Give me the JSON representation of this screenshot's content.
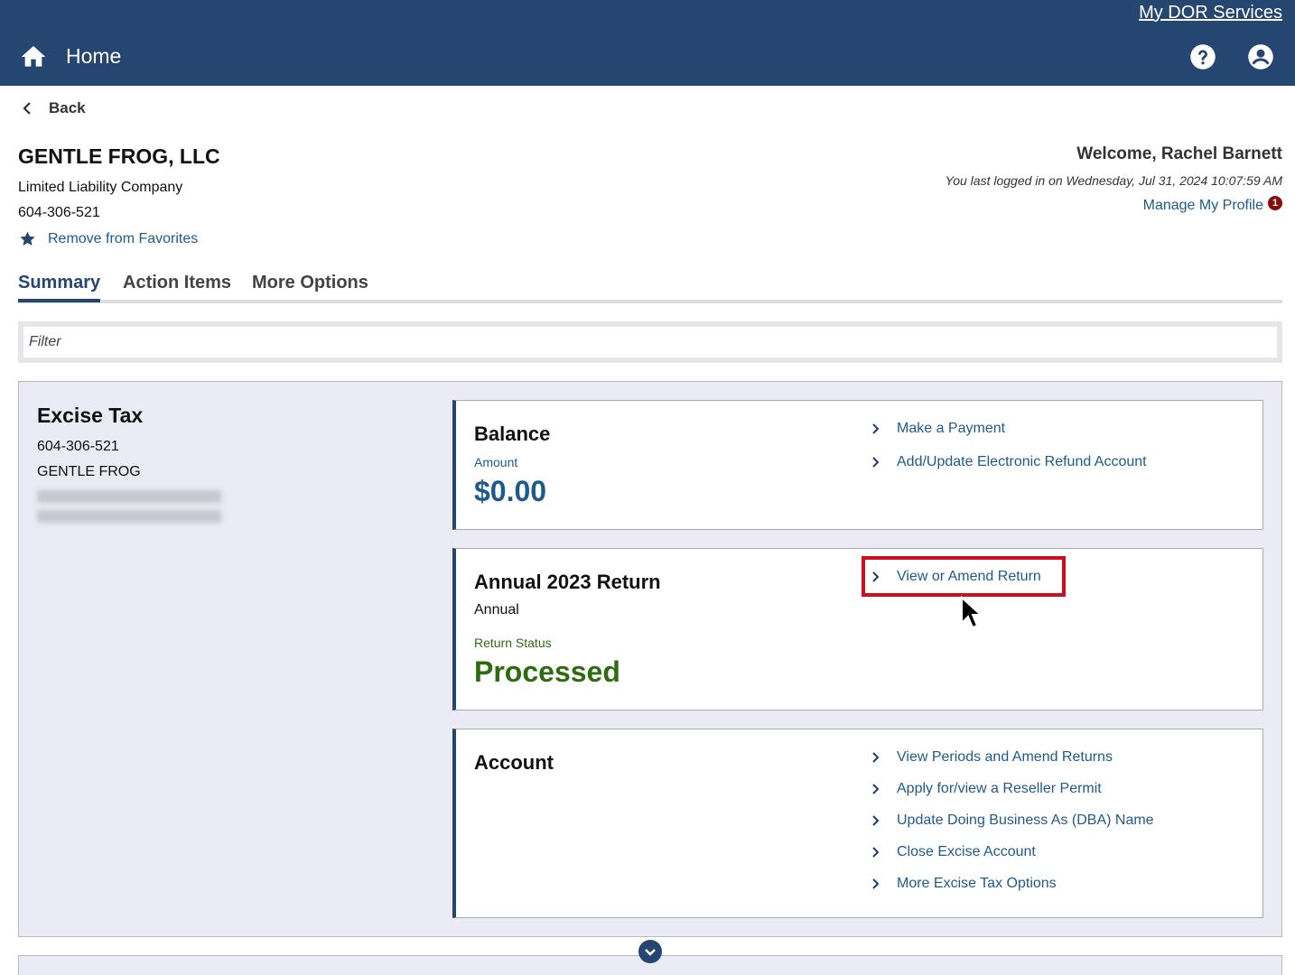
{
  "header": {
    "my_dor_services": "My DOR Services",
    "home_label": "Home"
  },
  "nav": {
    "back_label": "Back"
  },
  "business": {
    "name": "GENTLE FROG, LLC",
    "type": "Limited Liability Company",
    "id": "604-306-521",
    "favorite_label": "Remove from Favorites"
  },
  "user": {
    "welcome": "Welcome, Rachel Barnett",
    "last_login": "You last logged in on Wednesday, Jul 31, 2024 10:07:59 AM",
    "manage_profile": "Manage My Profile",
    "notification_count": "1"
  },
  "tabs": [
    {
      "label": "Summary",
      "active": true
    },
    {
      "label": "Action Items",
      "active": false
    },
    {
      "label": "More Options",
      "active": false
    }
  ],
  "filter": {
    "placeholder": "Filter"
  },
  "excise": {
    "title": "Excise Tax",
    "account_id": "604-306-521",
    "account_name": "GENTLE FROG"
  },
  "balance_card": {
    "title": "Balance",
    "amount_label": "Amount",
    "amount_value": "$0.00",
    "links": [
      "Make a Payment",
      "Add/Update Electronic Refund Account"
    ]
  },
  "return_card": {
    "title": "Annual 2023 Return",
    "frequency": "Annual",
    "status_label": "Return Status",
    "status_value": "Processed",
    "links": [
      "View or Amend Return"
    ]
  },
  "account_card": {
    "title": "Account",
    "links": [
      "View Periods and Amend Returns",
      "Apply for/view a Reseller Permit",
      "Update Doing Business As (DBA) Name",
      "Close Excise Account",
      "More Excise Tax Options"
    ]
  },
  "colors": {
    "header_bg": "#244670",
    "link": "#1f5a8c",
    "status_green": "#2e6b12",
    "highlight_red": "#cc0e1f",
    "badge_red": "#8a0b0b"
  }
}
